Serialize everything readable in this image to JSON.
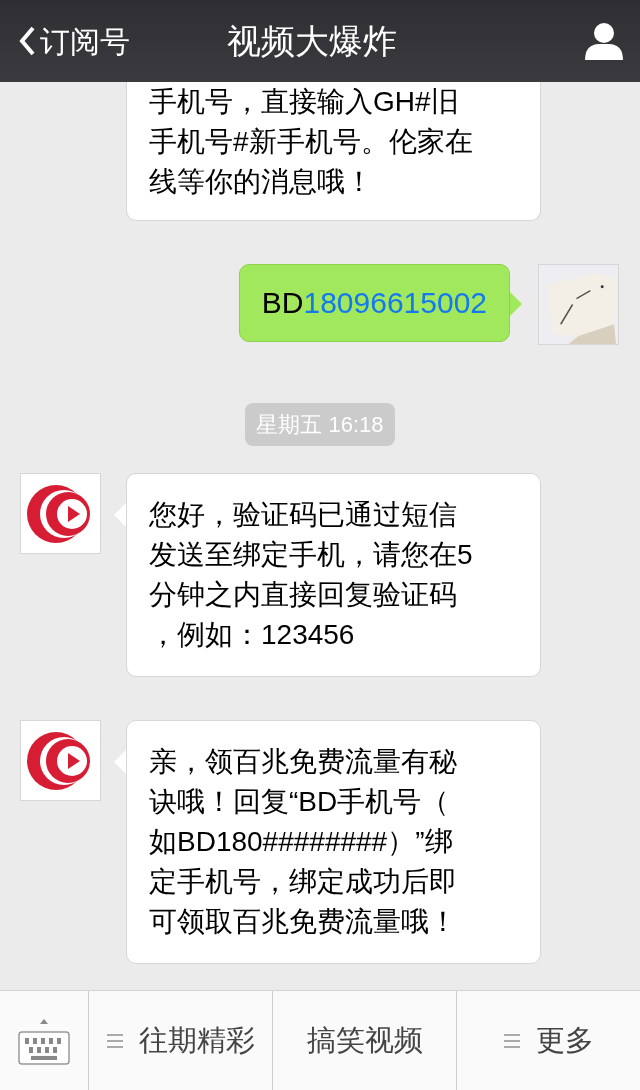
{
  "header": {
    "back_label": "订阅号",
    "title": "视频大爆炸"
  },
  "messages": [
    {
      "kind": "received",
      "cut": true,
      "lines": [
        "手机号，直接输入GH#旧",
        "手机号#新手机号。伦家在",
        "线等你的消息哦！"
      ]
    },
    {
      "kind": "sent",
      "text": "BD",
      "link": "18096615002"
    },
    {
      "kind": "timestamp",
      "text": "星期五 16:18"
    },
    {
      "kind": "received",
      "cut": false,
      "lines": [
        "您好，验证码已通过短信",
        "发送至绑定手机，请您在5",
        "分钟之内直接回复验证码",
        "，例如：123456"
      ]
    },
    {
      "kind": "received",
      "cut": false,
      "lines": [
        "亲，领百兆免费流量有秘",
        "诀哦！回复“BD手机号（",
        "如BD180########）”绑",
        "定手机号，绑定成功后即",
        "可领取百兆免费流量哦！"
      ]
    }
  ],
  "menu": [
    {
      "label": "往期精彩",
      "has_submenu": true
    },
    {
      "label": "搞笑视频",
      "has_submenu": false
    },
    {
      "label": "更多",
      "has_submenu": true
    }
  ]
}
